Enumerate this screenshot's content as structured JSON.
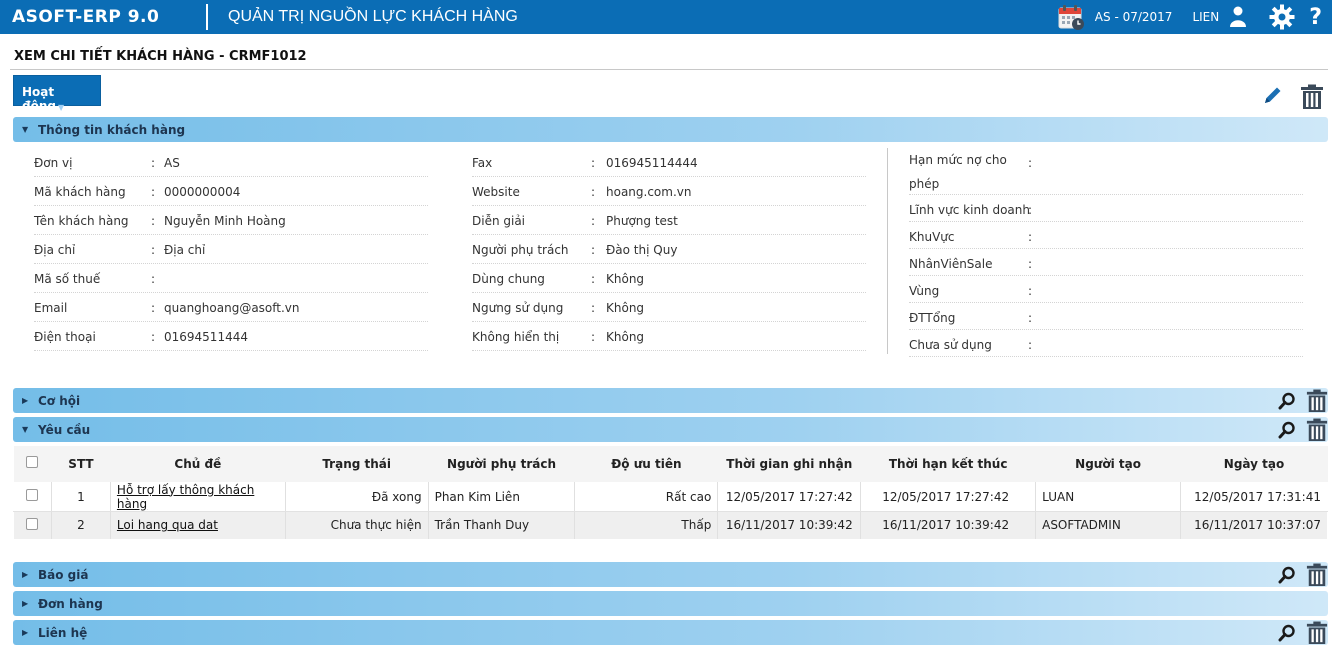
{
  "app": {
    "brand": "ASOFT-ERP 9.0",
    "module": "QUẢN TRỊ NGUỒN LỰC KHÁCH HÀNG",
    "period": "AS - 07/2017",
    "user": "LIEN",
    "icons": [
      "calendar-icon",
      "user-icon",
      "gear-icon",
      "help-icon"
    ]
  },
  "page": {
    "title": "XEM CHI TIẾT KHÁCH HÀNG - CRMF1012",
    "action_label": "Hoạt động"
  },
  "info_section": {
    "label": "Thông tin khách hàng",
    "col1": [
      {
        "k": "Đơn vị",
        "v": "AS"
      },
      {
        "k": "Mã khách hàng",
        "v": "0000000004"
      },
      {
        "k": "Tên khách hàng",
        "v": "Nguyễn Minh Hoàng"
      },
      {
        "k": "Địa chỉ",
        "v": "Địa chỉ"
      },
      {
        "k": "Mã số thuế",
        "v": ""
      },
      {
        "k": "Email",
        "v": "quanghoang@asoft.vn"
      },
      {
        "k": "Điện thoại",
        "v": "01694511444"
      }
    ],
    "col2": [
      {
        "k": "Fax",
        "v": "016945114444"
      },
      {
        "k": "Website",
        "v": "hoang.com.vn"
      },
      {
        "k": "Diễn giải",
        "v": "Phượng test"
      },
      {
        "k": "Người phụ trách",
        "v": "Đào thị Quy"
      },
      {
        "k": "Dùng chung",
        "v": "Không"
      },
      {
        "k": "Ngưng sử dụng",
        "v": "Không"
      },
      {
        "k": "Không hiển thị",
        "v": "Không"
      }
    ],
    "col3": [
      {
        "k": "Hạn mức nợ cho phép",
        "v": ""
      },
      {
        "k": "Lĩnh vực kinh doanh",
        "v": ""
      },
      {
        "k": "KhuVực",
        "v": ""
      },
      {
        "k": "NhânViênSale",
        "v": ""
      },
      {
        "k": "Vùng",
        "v": ""
      },
      {
        "k": "ĐTTổng",
        "v": ""
      },
      {
        "k": "Chưa sử dụng",
        "v": ""
      }
    ]
  },
  "sections": {
    "co_hoi": "Cơ hội",
    "yeu_cau": "Yêu cầu",
    "bao_gia": "Báo giá",
    "don_hang": "Đơn hàng",
    "lien_he": "Liên hệ"
  },
  "requests_table": {
    "headers": [
      "STT",
      "Chủ đề",
      "Trạng thái",
      "Người phụ trách",
      "Độ ưu tiên",
      "Thời gian ghi nhận",
      "Thời hạn kết thúc",
      "Người tạo",
      "Ngày tạo"
    ],
    "rows": [
      {
        "stt": "1",
        "topic": "Hỗ trợ lấy thông khách hàng",
        "status": "Đã xong",
        "owner": "Phan Kim Liên",
        "priority": "Rất cao",
        "recorded": "12/05/2017 17:27:42",
        "deadline": "12/05/2017 17:27:42",
        "creator": "LUAN",
        "created": "12/05/2017 17:31:41"
      },
      {
        "stt": "2",
        "topic": "Loi hang qua dat",
        "status": "Chưa thực hiện",
        "owner": "Trần Thanh Duy",
        "priority": "Thấp",
        "recorded": "16/11/2017 10:39:42",
        "deadline": "16/11/2017 10:39:42",
        "creator": "ASOFTADMIN",
        "created": "16/11/2017 10:37:07"
      }
    ]
  }
}
